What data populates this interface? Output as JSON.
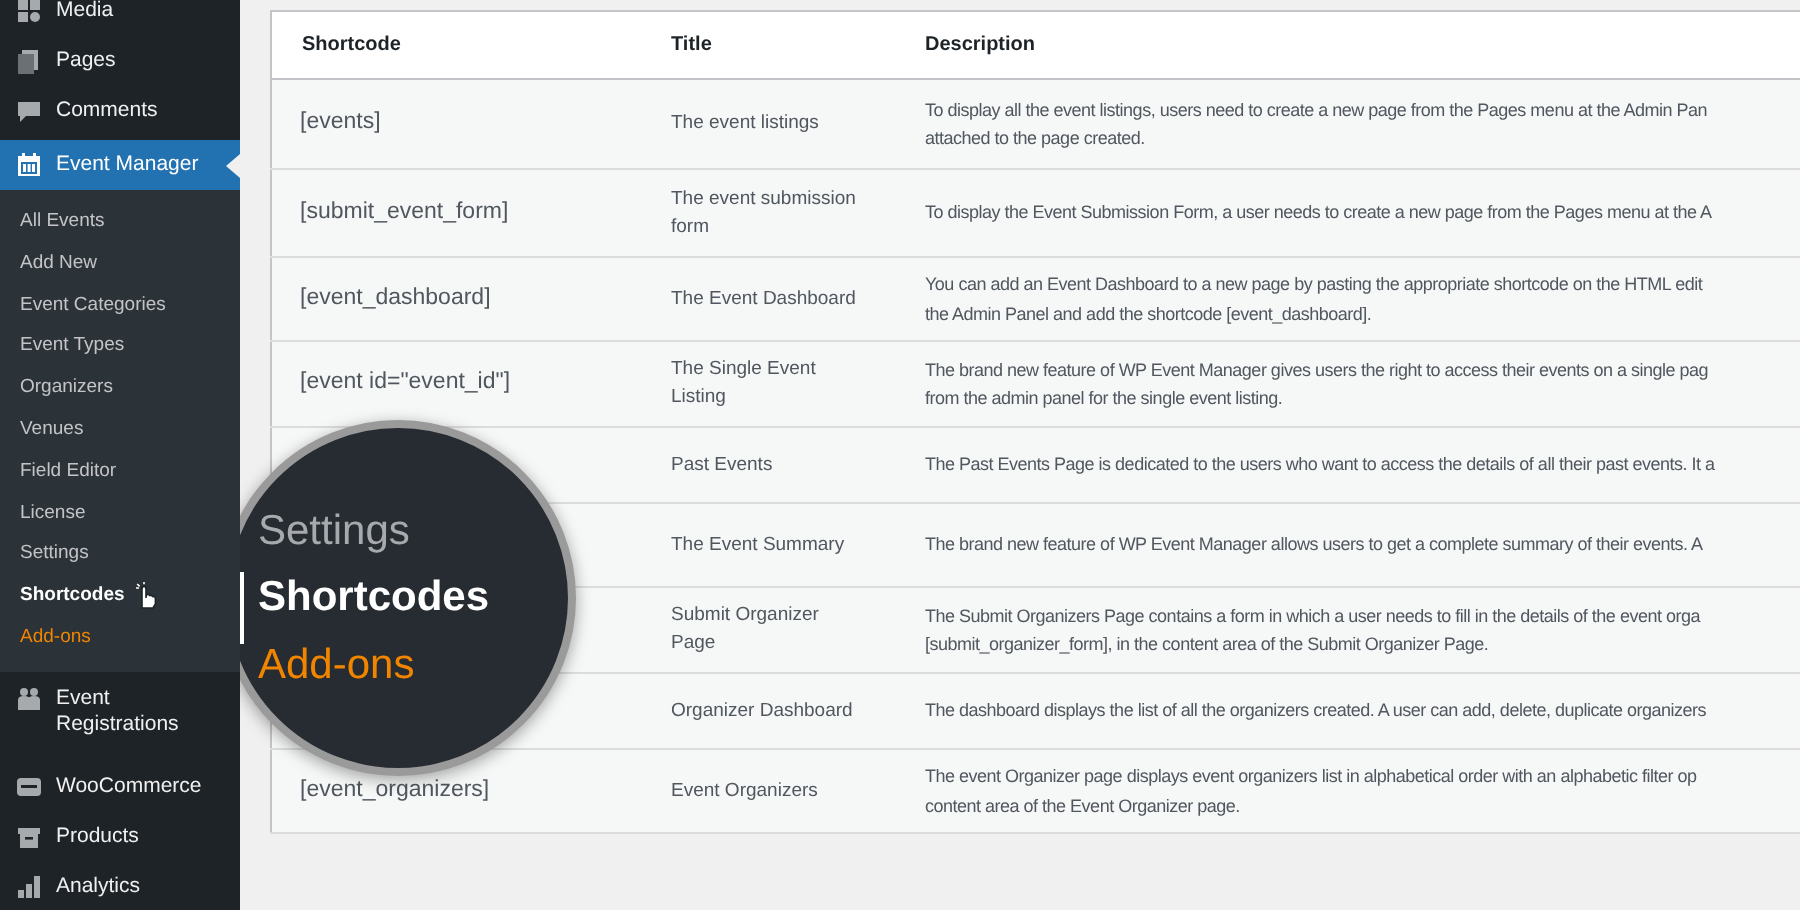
{
  "sidebar": {
    "top_items": [
      {
        "label": "Media"
      },
      {
        "label": "Pages"
      },
      {
        "label": "Comments"
      }
    ],
    "active_menu": {
      "label": "Event Manager",
      "selected": true,
      "expanded": true,
      "submenu": [
        {
          "label": "All Events",
          "selected": false,
          "kind": "link"
        },
        {
          "label": "Add New",
          "selected": false,
          "kind": "link"
        },
        {
          "label": "Event Categories",
          "selected": false,
          "kind": "link"
        },
        {
          "label": "Event Types",
          "selected": false,
          "kind": "link"
        },
        {
          "label": "Organizers",
          "selected": false,
          "kind": "link"
        },
        {
          "label": "Venues",
          "selected": false,
          "kind": "link"
        },
        {
          "label": "Field Editor",
          "selected": false,
          "kind": "link"
        },
        {
          "label": "License",
          "selected": false,
          "kind": "link"
        },
        {
          "label": "Settings",
          "selected": false,
          "kind": "link"
        },
        {
          "label": "Shortcodes",
          "selected": true,
          "kind": "link"
        },
        {
          "label": "Add-ons",
          "selected": false,
          "kind": "promo"
        }
      ]
    },
    "bottom_items": [
      {
        "label": "Event Registrations"
      },
      {
        "label": "WooCommerce"
      },
      {
        "label": "Products"
      },
      {
        "label": "Analytics"
      }
    ]
  },
  "magnifier": {
    "items": [
      {
        "label": "Settings",
        "selected": false,
        "kind": "link"
      },
      {
        "label": "Shortcodes",
        "selected": true,
        "kind": "link"
      },
      {
        "label": "Add-ons",
        "selected": false,
        "kind": "promo"
      }
    ]
  },
  "table": {
    "columns": [
      "Shortcode",
      "Title",
      "Description"
    ],
    "rows": [
      {
        "shortcode": "[events]",
        "title": "The event listings",
        "description": [
          "To display all the event listings, users need to create a new page from the Pages menu at the Admin Pan",
          "attached to the page created."
        ]
      },
      {
        "shortcode": "[submit_event_form]",
        "title": "The event submission form",
        "description": [
          "To display the Event Submission Form, a user needs to create a new page from the Pages menu at the A"
        ]
      },
      {
        "shortcode": "[event_dashboard]",
        "title": "The Event Dashboard",
        "description": [
          "You can add an Event Dashboard to a new page by pasting the appropriate shortcode on the HTML edit",
          "the Admin Panel and add the shortcode [event_dashboard]."
        ]
      },
      {
        "shortcode": "[event id=\"event_id\"]",
        "title": "The Single Event Listing",
        "description": [
          "The brand new feature of WP Event Manager gives users the right to access their events on a single pag",
          "from the admin panel for the single event listing."
        ]
      },
      {
        "title": "Past Events",
        "description": [
          "The Past Events Page is dedicated to the users who want to access the details of all their past events. It a"
        ]
      },
      {
        "title": "The Event Summary",
        "description": [
          "The brand new feature of WP Event Manager allows users to get a complete summary of their events. A"
        ]
      },
      {
        "title": "Submit Organizer Page",
        "description": [
          "The Submit Organizers Page contains a form in which a user needs to fill in the details of the event orga",
          "[submit_organizer_form], in the content area of the Submit Organizer Page."
        ]
      },
      {
        "title": "Organizer Dashboard",
        "description": [
          "The dashboard displays the list of all the organizers created. A user can add, delete, duplicate organizers"
        ]
      },
      {
        "shortcode": "[event_organizers]",
        "title": "Event Organizers",
        "description": [
          "The event Organizer page displays event organizers list in alphabetical order with an alphabetic filter op",
          "content area of the Event Organizer page."
        ]
      }
    ]
  }
}
